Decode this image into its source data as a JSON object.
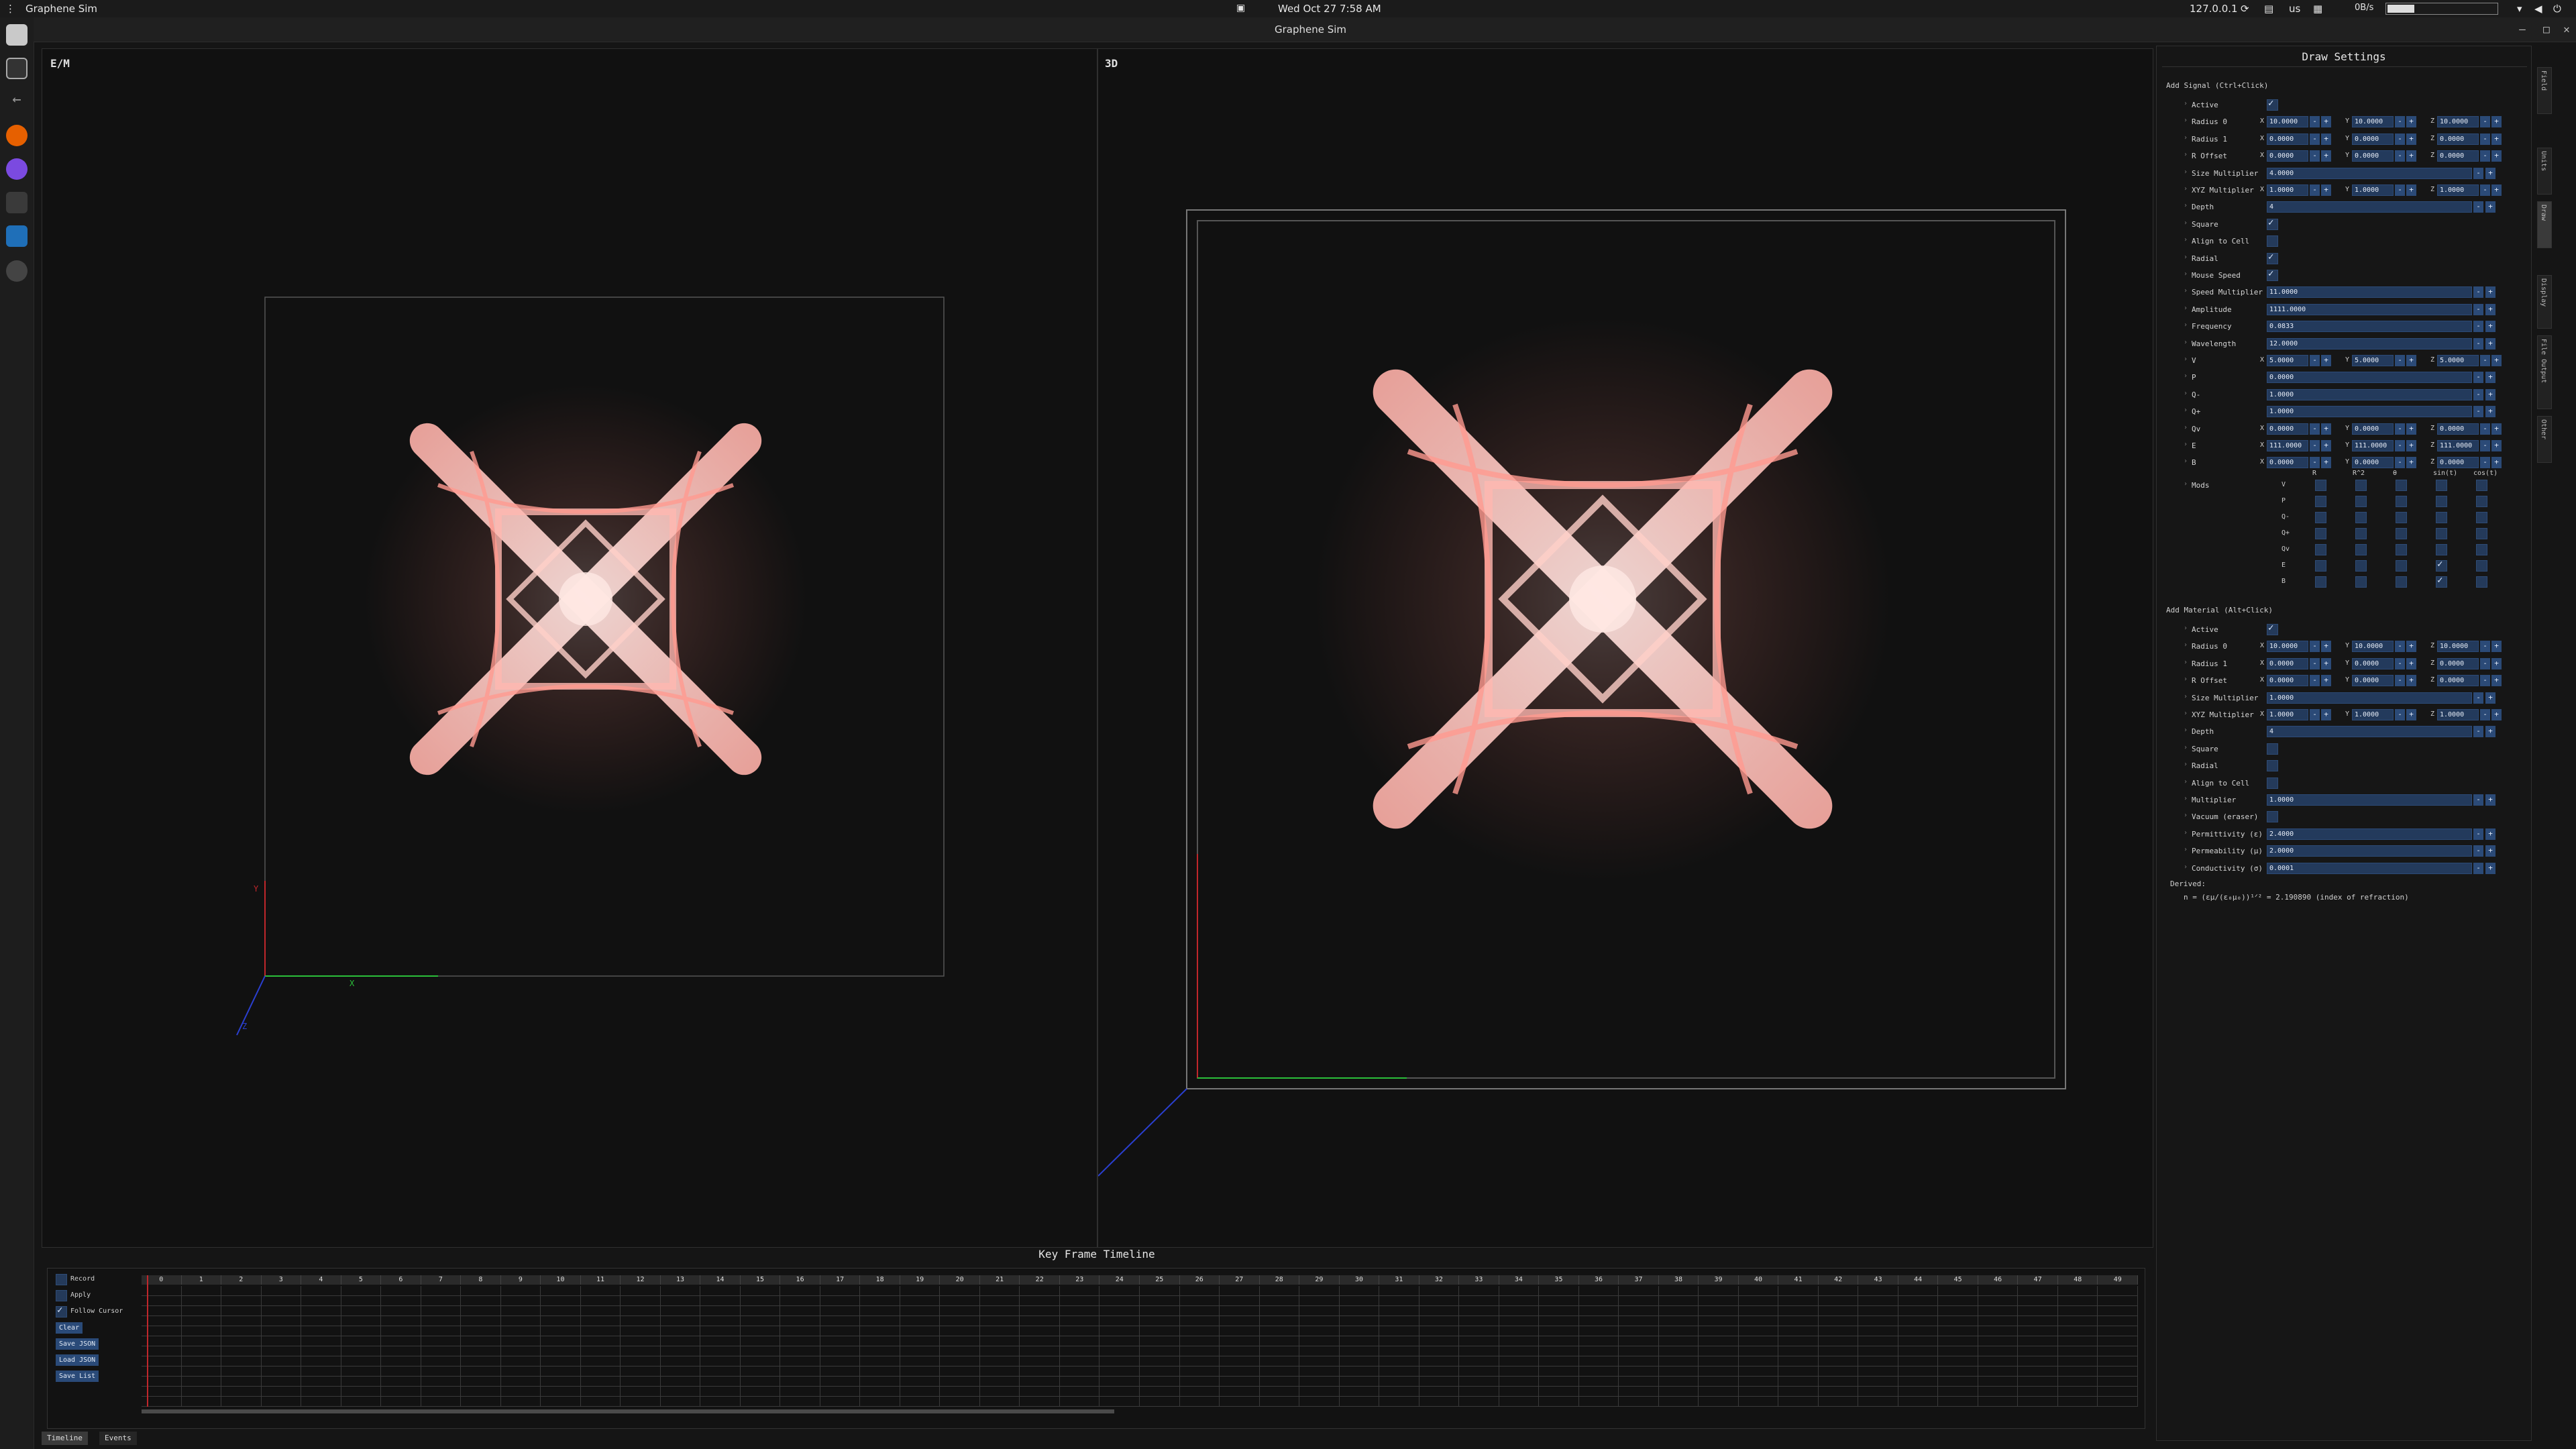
{
  "topbar": {
    "app_name": "Graphene Sim",
    "clock": "Wed Oct 27  7:58 AM",
    "ip": "127.0.0.1",
    "keyboard": "us",
    "netspeed": "0B/s"
  },
  "window": {
    "title": "Graphene Sim"
  },
  "views": {
    "left_label": "E/M",
    "right_label": "3D",
    "axis_x": "X",
    "axis_y": "Y",
    "axis_z": "Z"
  },
  "settings": {
    "title": "Draw Settings",
    "signal": {
      "header": "Add Signal (Ctrl+Click)",
      "active_label": "Active",
      "radius0": {
        "label": "Radius 0",
        "x": "10.0000",
        "y": "10.0000",
        "z": "10.0000"
      },
      "radius1": {
        "label": "Radius 1",
        "x": "0.0000",
        "y": "0.0000",
        "z": "0.0000"
      },
      "roffset": {
        "label": "R Offset",
        "x": "0.0000",
        "y": "0.0000",
        "z": "0.0000"
      },
      "sizemult": {
        "label": "Size Multiplier",
        "v": "4.0000"
      },
      "xyzmult": {
        "label": "XYZ Multiplier",
        "x": "1.0000",
        "y": "1.0000",
        "z": "1.0000"
      },
      "depth": {
        "label": "Depth",
        "v": "4"
      },
      "square": "Square",
      "align": "Align to Cell",
      "radial": "Radial",
      "mousespeed": "Mouse Speed",
      "speedmult": {
        "label": "Speed Multiplier",
        "v": "11.0000"
      },
      "amplitude": {
        "label": "Amplitude",
        "v": "1111.0000"
      },
      "frequency": {
        "label": "Frequency",
        "v": "0.0833"
      },
      "wavelength": {
        "label": "Wavelength",
        "v": "12.0000"
      },
      "V": {
        "label": "V",
        "x": "5.0000",
        "y": "5.0000",
        "z": "5.0000"
      },
      "P": {
        "label": "P",
        "v": "0.0000"
      },
      "Qm": {
        "label": "Q-",
        "v": "1.0000"
      },
      "Qp": {
        "label": "Q+",
        "v": "1.0000"
      },
      "Qv": {
        "label": "Qv",
        "x": "0.0000",
        "y": "0.0000",
        "z": "0.0000"
      },
      "E": {
        "label": "E",
        "x": "111.0000",
        "y": "111.0000",
        "z": "111.0000"
      },
      "B": {
        "label": "B",
        "x": "0.0000",
        "y": "0.0000",
        "z": "0.0000"
      },
      "mods": {
        "label": "Mods",
        "cols": [
          "R",
          "R^2",
          "θ",
          "sin(t)",
          "cos(t)"
        ],
        "rows": [
          "V",
          "P",
          "Q-",
          "Q+",
          "Qv",
          "E",
          "B"
        ]
      }
    },
    "material": {
      "header": "Add Material (Alt+Click)",
      "active_label": "Active",
      "radius0": {
        "label": "Radius 0",
        "x": "10.0000",
        "y": "10.0000",
        "z": "10.0000"
      },
      "radius1": {
        "label": "Radius 1",
        "x": "0.0000",
        "y": "0.0000",
        "z": "0.0000"
      },
      "roffset": {
        "label": "R Offset",
        "x": "0.0000",
        "y": "0.0000",
        "z": "0.0000"
      },
      "sizemult": {
        "label": "Size Multiplier",
        "v": "1.0000"
      },
      "xyzmult": {
        "label": "XYZ Multiplier",
        "x": "1.0000",
        "y": "1.0000",
        "z": "1.0000"
      },
      "depth": {
        "label": "Depth",
        "v": "4"
      },
      "square": "Square",
      "radial": "Radial",
      "align": "Align to Cell",
      "multiplier": {
        "label": "Multiplier",
        "v": "1.0000"
      },
      "vacuum": "Vacuum (eraser)",
      "permittivity": {
        "label": "Permittivity (ε)",
        "v": "2.4000"
      },
      "permeability": {
        "label": "Permeability (μ)",
        "v": "2.0000"
      },
      "conductivity": {
        "label": "Conductivity (σ)",
        "v": "0.0001"
      }
    },
    "derived": {
      "label": "Derived:",
      "formula": "n = (εμ/(ε₀μ₀))¹ᐟ² = 2.190890  (index of refraction)"
    }
  },
  "sidetabs": [
    "Field",
    "Units",
    "Draw",
    "Display",
    "File Output",
    "Other"
  ],
  "timeline": {
    "title": "Key Frame Timeline",
    "record": "Record",
    "apply": "Apply",
    "follow": "Follow Cursor",
    "clear": "Clear",
    "save_json": "Save JSON",
    "load_json": "Load JSON",
    "save_list": "Save List",
    "frames": [
      "0",
      "1",
      "2",
      "3",
      "4",
      "5",
      "6",
      "7",
      "8",
      "9",
      "10",
      "11",
      "12",
      "13",
      "14",
      "15",
      "16",
      "17",
      "18",
      "19",
      "20",
      "21",
      "22",
      "23",
      "24",
      "25",
      "26",
      "27",
      "28",
      "29",
      "30",
      "31",
      "32",
      "33",
      "34",
      "35",
      "36",
      "37",
      "38",
      "39",
      "40",
      "41",
      "42",
      "43",
      "44",
      "45",
      "46",
      "47",
      "48",
      "49"
    ]
  },
  "bottom_tabs": {
    "timeline": "Timeline",
    "events": "Events"
  },
  "colors": {
    "accent": "#2a4a78",
    "field_glow": "#ff9a90",
    "axis_x": "#2bbf3a",
    "axis_y": "#c0262b",
    "axis_z": "#2a3fd0"
  }
}
